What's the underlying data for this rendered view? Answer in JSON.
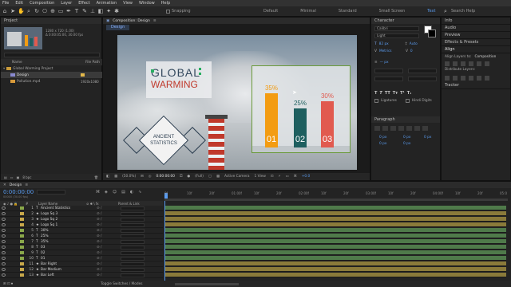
{
  "menu": [
    "File",
    "Edit",
    "Composition",
    "Layer",
    "Effect",
    "Animation",
    "View",
    "Window",
    "Help"
  ],
  "toolbar": {
    "snapping": "Snapping",
    "workspaces": [
      "Default",
      "Minimal",
      "Standard",
      "Small Screen",
      "Text"
    ],
    "active_workspace": "Text",
    "search_placeholder": "Search Help"
  },
  "project": {
    "title": "Project",
    "thumb_info": "1280 x 720 (1.00)\nΔ 0:00:05:00, 30.00 fps",
    "col_name": "Name",
    "col_type": "",
    "col_size": "File Path",
    "items": [
      {
        "name": "Global Warming Project",
        "size": ""
      },
      {
        "name": "Design",
        "size": "",
        "selected": true
      },
      {
        "name": "Pollution.mp4",
        "size": "1920x1080"
      }
    ],
    "footer": "8 bpc"
  },
  "composition": {
    "tab": "Composition: Design",
    "subtab": "Design",
    "zoom": "(50.0%)",
    "time": "0:00:00:00",
    "resolution": "(Full)",
    "camera": "Active Camera",
    "views": "1 View",
    "offset": "+0.0"
  },
  "slide": {
    "title_line1": "GLOBAL",
    "title_line2": "WARMING",
    "diamond_text": "ANCIENT\nSTATISTICS",
    "colors": {
      "orange": "#f39c12",
      "teal": "#1e5f5f",
      "coral": "#e15a4f"
    }
  },
  "chart_data": {
    "type": "bar",
    "categories": [
      "01",
      "02",
      "03"
    ],
    "values": [
      35,
      25,
      30
    ],
    "value_labels": [
      "35%",
      "25%",
      "30%"
    ],
    "colors": [
      "#f39c12",
      "#1e5f5f",
      "#e15a4f"
    ]
  },
  "character": {
    "title": "Character",
    "font": "Calibri",
    "style": "Light",
    "size": "82 px",
    "leading": "Auto",
    "kerning": "Metrics",
    "tracking": "0",
    "stroke": "— px",
    "ligatures": "Ligatures",
    "hindi": "Hindi Digits"
  },
  "paragraph": {
    "title": "Paragraph",
    "indent_values": [
      "0 px",
      "0 px",
      "0 px",
      "0 px",
      "0 px"
    ]
  },
  "right_panels": {
    "info": "Info",
    "audio": "Audio",
    "preview": "Preview",
    "effects": "Effects & Presets",
    "align": "Align",
    "align_to_label": "Align Layers to:",
    "align_to": "Composition",
    "distribute": "Distribute Layers:",
    "tracker": "Tracker"
  },
  "timeline": {
    "tab": "Design",
    "time": "0:00:00:00",
    "fps_info": "00000 (30.00 fps)",
    "col_layer": "Layer Name",
    "col_parent": "Parent & Link",
    "footer": "Toggle Switches / Modes",
    "ruler": [
      "0f",
      "10f",
      "20f",
      "01:00f",
      "10f",
      "20f",
      "02:00f",
      "10f",
      "20f",
      "03:00f",
      "10f",
      "20f",
      "04:00f",
      "10f",
      "20f",
      "05:0"
    ],
    "layers": [
      {
        "num": "1",
        "type": "T",
        "name": "Ancient Statistics",
        "color": "#8aa84a"
      },
      {
        "num": "2",
        "type": "★",
        "name": "Logo Sq 3",
        "color": "#c8a84a"
      },
      {
        "num": "3",
        "type": "★",
        "name": "Logo Sq 2",
        "color": "#c8a84a"
      },
      {
        "num": "4",
        "type": "★",
        "name": "Logo Sq 1",
        "color": "#c8a84a"
      },
      {
        "num": "5",
        "type": "T",
        "name": "30%",
        "color": "#8aa84a"
      },
      {
        "num": "6",
        "type": "T",
        "name": "25%",
        "color": "#8aa84a"
      },
      {
        "num": "7",
        "type": "T",
        "name": "35%",
        "color": "#8aa84a"
      },
      {
        "num": "8",
        "type": "T",
        "name": "03",
        "color": "#8aa84a"
      },
      {
        "num": "9",
        "type": "T",
        "name": "02",
        "color": "#8aa84a"
      },
      {
        "num": "10",
        "type": "T",
        "name": "01",
        "color": "#8aa84a"
      },
      {
        "num": "11",
        "type": "★",
        "name": "Bar Right",
        "color": "#c8a84a"
      },
      {
        "num": "12",
        "type": "★",
        "name": "Bar Medium",
        "color": "#c8a84a"
      },
      {
        "num": "13",
        "type": "★",
        "name": "Bar Left",
        "color": "#c8a84a"
      }
    ]
  }
}
